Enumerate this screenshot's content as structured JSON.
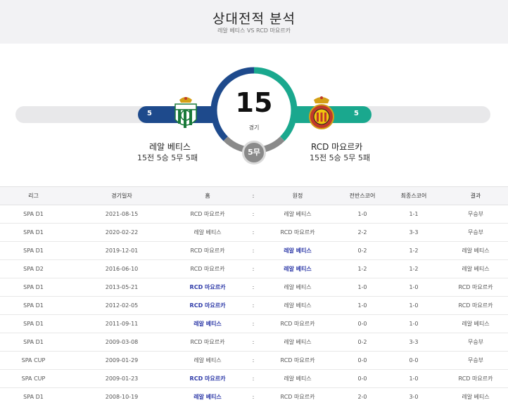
{
  "header": {
    "title": "상대전적 분석",
    "subtitle": "레알 베티스 VS RCD 마요르카"
  },
  "summary": {
    "total": "15",
    "total_label": "경기",
    "draws": "5무",
    "home": {
      "name": "레알 베티스",
      "wins": "5",
      "win_count": 5,
      "record": "15전 5승 5무 5패"
    },
    "away": {
      "name": "RCD 마요르카",
      "wins": "5",
      "win_count": 5,
      "record": "15전 5승 5무 5패"
    },
    "colors": {
      "home": "#1e4a8c",
      "away": "#1aa88e",
      "draw": "#8a8a8a"
    }
  },
  "table": {
    "headers": {
      "league": "리그",
      "date": "경기일자",
      "home": "홈",
      "sep": ":",
      "away": "원정",
      "half": "전반스코어",
      "full": "최종스코어",
      "result": "결과"
    },
    "rows": [
      {
        "league": "SPA D1",
        "date": "2021-08-15",
        "home": "RCD 마요르카",
        "sep": ":",
        "away": "레알 베티스",
        "half": "1-0",
        "full": "1-1",
        "result": "무승부",
        "winner": ""
      },
      {
        "league": "SPA D1",
        "date": "2020-02-22",
        "home": "레알 베티스",
        "sep": ":",
        "away": "RCD 마요르카",
        "half": "2-2",
        "full": "3-3",
        "result": "무승부",
        "winner": ""
      },
      {
        "league": "SPA D1",
        "date": "2019-12-01",
        "home": "RCD 마요르카",
        "sep": ":",
        "away": "레알 베티스",
        "half": "0-2",
        "full": "1-2",
        "result": "레알 베티스",
        "winner": "away"
      },
      {
        "league": "SPA D2",
        "date": "2016-06-10",
        "home": "RCD 마요르카",
        "sep": ":",
        "away": "레알 베티스",
        "half": "1-2",
        "full": "1-2",
        "result": "레알 베티스",
        "winner": "away"
      },
      {
        "league": "SPA D1",
        "date": "2013-05-21",
        "home": "RCD 마요르카",
        "sep": ":",
        "away": "레알 베티스",
        "half": "1-0",
        "full": "1-0",
        "result": "RCD 마요르카",
        "winner": "home"
      },
      {
        "league": "SPA D1",
        "date": "2012-02-05",
        "home": "RCD 마요르카",
        "sep": ":",
        "away": "레알 베티스",
        "half": "1-0",
        "full": "1-0",
        "result": "RCD 마요르카",
        "winner": "home"
      },
      {
        "league": "SPA D1",
        "date": "2011-09-11",
        "home": "레알 베티스",
        "sep": ":",
        "away": "RCD 마요르카",
        "half": "0-0",
        "full": "1-0",
        "result": "레알 베티스",
        "winner": "home"
      },
      {
        "league": "SPA D1",
        "date": "2009-03-08",
        "home": "RCD 마요르카",
        "sep": ":",
        "away": "레알 베티스",
        "half": "0-2",
        "full": "3-3",
        "result": "무승부",
        "winner": ""
      },
      {
        "league": "SPA CUP",
        "date": "2009-01-29",
        "home": "레알 베티스",
        "sep": ":",
        "away": "RCD 마요르카",
        "half": "0-0",
        "full": "0-0",
        "result": "무승부",
        "winner": ""
      },
      {
        "league": "SPA CUP",
        "date": "2009-01-23",
        "home": "RCD 마요르카",
        "sep": ":",
        "away": "레알 베티스",
        "half": "0-0",
        "full": "1-0",
        "result": "RCD 마요르카",
        "winner": "home"
      },
      {
        "league": "SPA D1",
        "date": "2008-10-19",
        "home": "레알 베티스",
        "sep": ":",
        "away": "RCD 마요르카",
        "half": "2-0",
        "full": "3-0",
        "result": "레알 베티스",
        "winner": "home"
      }
    ]
  }
}
